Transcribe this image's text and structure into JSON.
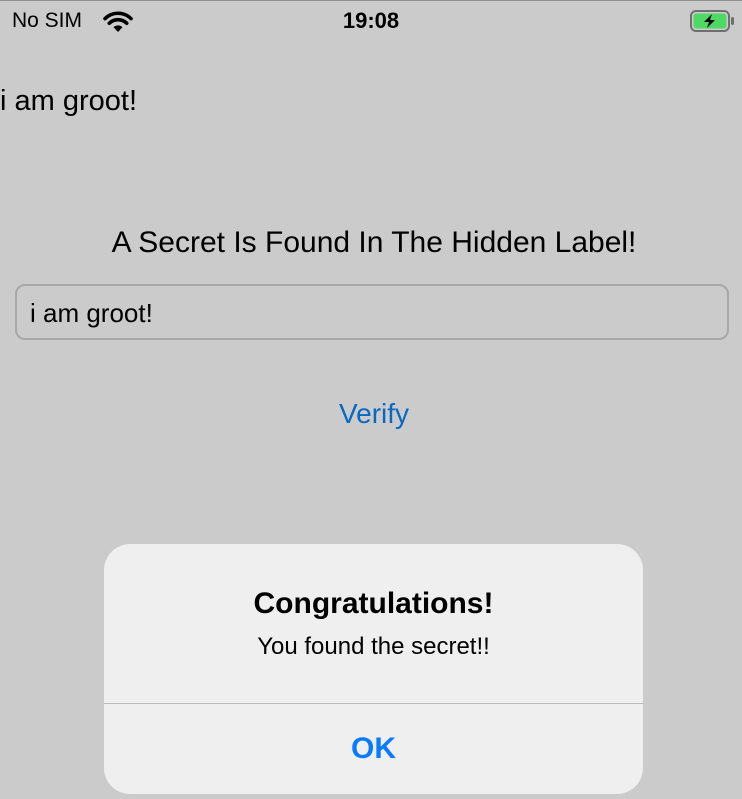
{
  "status_bar": {
    "carrier": "No SIM",
    "time": "19:08",
    "wifi_icon": "wifi-icon",
    "battery_icon": "battery-charging-icon"
  },
  "main": {
    "hidden_label": "i am groot!",
    "headline": "A Secret Is Found In The Hidden Label!",
    "text_field_value": "i am groot!",
    "verify_label": "Verify"
  },
  "alert": {
    "title": "Congratulations!",
    "message": "You found the secret!!",
    "ok_label": "OK"
  },
  "colors": {
    "background": "#cbcbcb",
    "link_blue": "#0a68c2",
    "alert_button_blue": "#0a7aff",
    "battery_green": "#4cd964"
  }
}
